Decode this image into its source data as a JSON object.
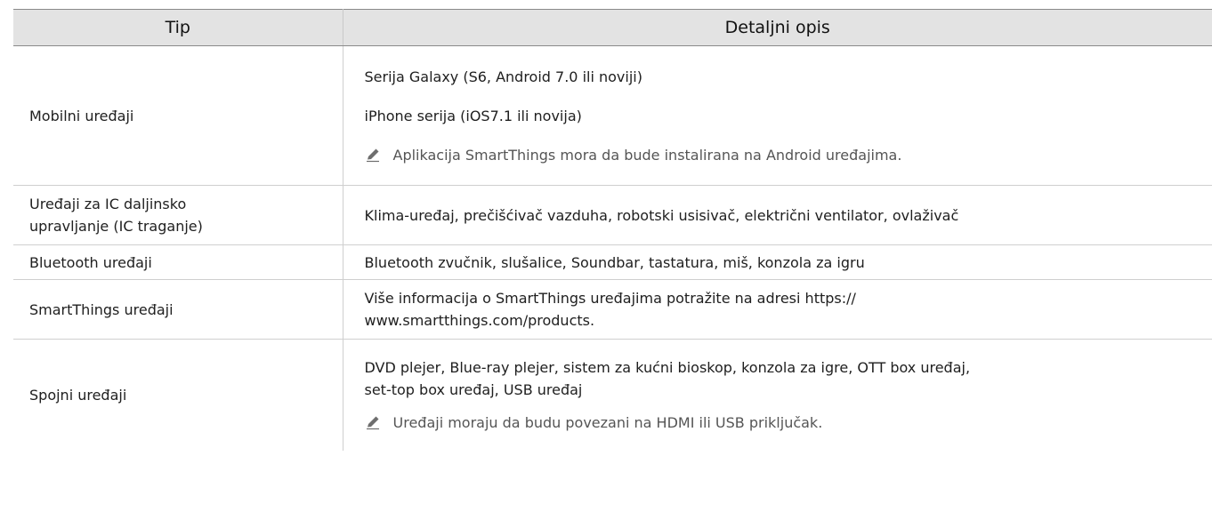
{
  "table": {
    "headers": [
      "Tip",
      "Detaljni opis"
    ],
    "rows": [
      {
        "type": "Mobilni uređaji",
        "lines": [
          "Serija Galaxy (S6, Android 7.0 ili noviji)",
          "iPhone serija (iOS7.1 ili novija)"
        ],
        "note": "Aplikacija SmartThings mora da bude instalirana na Android uređajima."
      },
      {
        "type_lines": [
          "Uređaji za IC daljinsko",
          "upravljanje (IC traganje)"
        ],
        "lines": [
          "Klima-uređaj, prečišćivač vazduha, robotski usisivač, električni ventilator, ovlaživač"
        ]
      },
      {
        "type": "Bluetooth uređaji",
        "lines": [
          "Bluetooth zvučnik, slušalice, Soundbar, tastatura, miš, konzola za igru"
        ]
      },
      {
        "type": "SmartThings uređaji",
        "lines": [
          "Više informacija o SmartThings uređajima potražite na adresi https://",
          "www.smartthings.com/products."
        ]
      },
      {
        "type": "Spojni uređaji",
        "lines": [
          "DVD plejer, Blue-ray plejer, sistem za kućni bioskop, konzola za igre, OTT box uređaj,",
          "set-top box uređaj, USB uređaj"
        ],
        "note": "Uređaji moraju da budu povezani na HDMI ili USB priključak."
      }
    ]
  },
  "icons": {
    "note": "pencil-note-icon"
  }
}
